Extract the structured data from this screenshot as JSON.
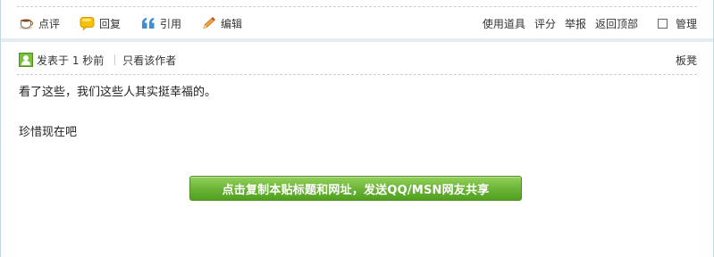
{
  "toolbar": {
    "left": [
      {
        "label": "点评",
        "icon": "coffee-cup-icon"
      },
      {
        "label": "回复",
        "icon": "speech-bubble-icon"
      },
      {
        "label": "引用",
        "icon": "quote-icon"
      },
      {
        "label": "编辑",
        "icon": "pencil-icon"
      }
    ],
    "right": {
      "use_tools": "使用道具",
      "rate": "评分",
      "report": "举报",
      "back_to_top": "返回顶部",
      "manage": "管理"
    }
  },
  "post": {
    "posted_time": "发表于 1 秒前",
    "only_author": "只看该作者",
    "floor": "板凳",
    "content_line1": "看了这些，我们这些人其实挺幸福的。",
    "content_line2": "珍惜现在吧"
  },
  "share": {
    "button_label": "点击复制本贴标题和网址，发送QQ/MSN网友共享"
  },
  "colors": {
    "border": "#c2d5e3",
    "separator": "#e4ebf1",
    "button_green": "#6cb538"
  }
}
